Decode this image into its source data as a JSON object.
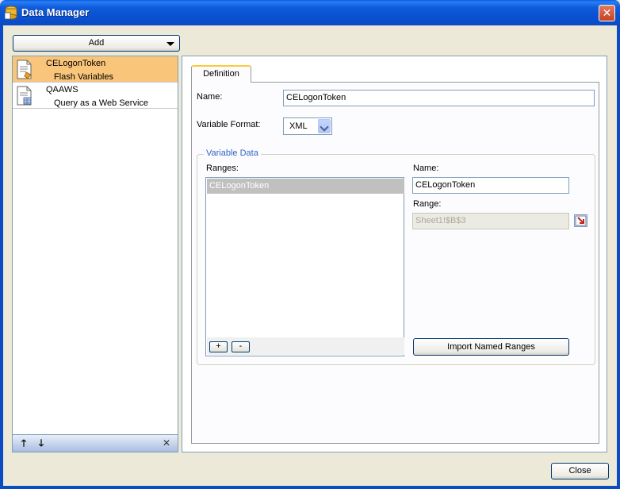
{
  "window": {
    "title": "Data Manager",
    "close_glyph": "✕"
  },
  "toolbar": {
    "add_label": "Add"
  },
  "connections": [
    {
      "name": "CELogonToken",
      "type": "Flash Variables",
      "selected": true
    },
    {
      "name": "QAAWS",
      "type": "Query as a Web Service",
      "selected": false
    }
  ],
  "list_footer": {
    "up_glyph": "🡑",
    "down_glyph": "🡓",
    "delete_glyph": "✕"
  },
  "tabs": [
    {
      "label": "Definition"
    }
  ],
  "definition": {
    "name_label": "Name:",
    "name_value": "CELogonToken",
    "format_label": "Variable Format:",
    "format_value": "XML"
  },
  "variable_data": {
    "title": "Variable Data",
    "ranges_label": "Ranges:",
    "ranges": [
      "CELogonToken"
    ],
    "add_glyph": "+",
    "remove_glyph": "-",
    "name_label": "Name:",
    "name_value": "CELogonToken",
    "range_label": "Range:",
    "range_value": "Sheet1!$B$3",
    "import_label": "Import Named Ranges"
  },
  "footer": {
    "close_label": "Close"
  },
  "colors": {
    "titlebar": "#0b4bc4",
    "selected_item": "#f9c57a",
    "group_title": "#2d64c8",
    "tab_highlight": "#ffc83c"
  }
}
